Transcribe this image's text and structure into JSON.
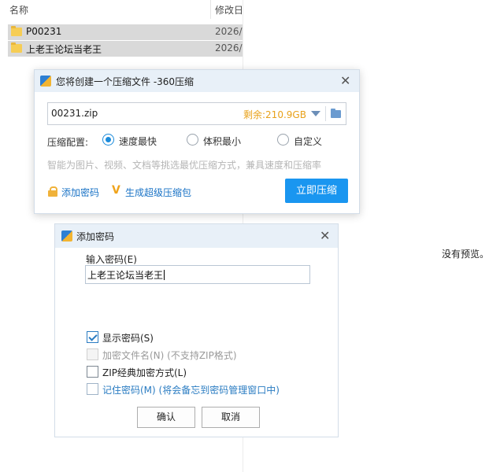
{
  "explorer": {
    "col_name": "名称",
    "col_date": "修改日",
    "sort_glyph": "^",
    "rows": [
      {
        "name": "P00231",
        "date": "2026/"
      },
      {
        "name": "上老王论坛当老王",
        "date": "2026/"
      }
    ],
    "preview_text": "没有预览。"
  },
  "compress_dialog": {
    "title": "您将创建一个压缩文件 -360压缩",
    "filename": "00231.zip",
    "free_space": "剩余:210.9GB",
    "config_label": "压缩配置:",
    "options": [
      "速度最快",
      "体积最小",
      "自定义"
    ],
    "selected_option": "速度最快",
    "hint": "智能为图片、视频、文档等挑选最优压缩方式，兼具速度和压缩率",
    "add_password": "添加密码",
    "super_compress": "生成超级压缩包",
    "compress_button": "立即压缩"
  },
  "password_dialog": {
    "title": "添加密码",
    "input_label": "输入密码(E)",
    "password_value": "上老王论坛当老王",
    "checkboxes": [
      {
        "label": "显示密码(S)",
        "checked": true,
        "disabled": false
      },
      {
        "label": "加密文件名(N) (不支持ZIP格式)",
        "checked": false,
        "disabled": true
      },
      {
        "label": "ZIP经典加密方式(L)",
        "checked": false,
        "disabled": false
      },
      {
        "label": "记住密码(M) (将会备忘到密码管理窗口中)",
        "checked": false,
        "disabled": false
      }
    ],
    "ok_button": "确认",
    "cancel_button": "取消"
  },
  "colors": {
    "accent": "#1a96f0",
    "free_space": "#e8a11a",
    "link": "#1a73c6",
    "selection": "#d9d9d9"
  }
}
